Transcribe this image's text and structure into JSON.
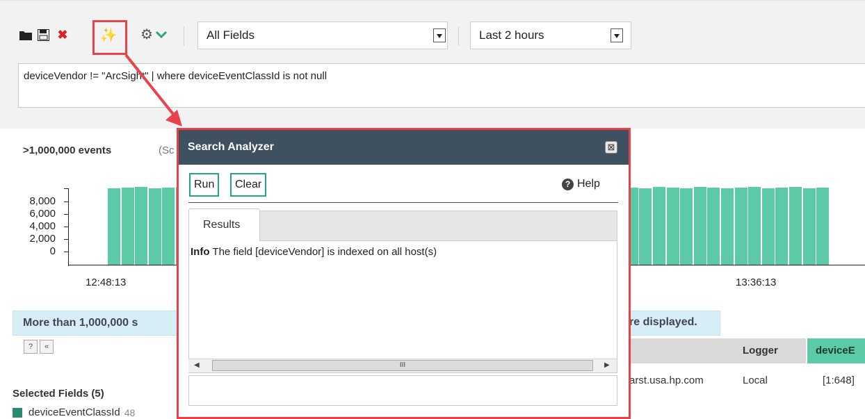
{
  "toolbar": {
    "icons": [
      "folder-icon",
      "save-icon",
      "delete-icon",
      "search-analyzer-icon",
      "settings-icon",
      "chevron-down-icon"
    ],
    "fields_select": "All Fields",
    "time_select": "Last 2 hours",
    "query": "deviceVendor != \"ArcSight\" | where deviceEventClassId is not null"
  },
  "summary": {
    "events_count": ">1,000,000 events",
    "events_suffix": "(Sc"
  },
  "histogram": {
    "yticks": [
      "8,000",
      "6,000",
      "4,000",
      "2,000",
      "0"
    ],
    "xticks": [
      "12:48:13",
      "13:36:13"
    ],
    "bar_color": "#5ccaa7"
  },
  "banner": {
    "text": "More than 1,000,000 s",
    "tail": "re displayed."
  },
  "table": {
    "col_logger": "Logger",
    "col_device": "deviceE",
    "row": {
      "host": "arst.usa.hp.com",
      "logger": "Local",
      "device": "[1:648]"
    }
  },
  "fields_panel": {
    "title": "Selected Fields (5)",
    "field": "deviceEventClassId",
    "count": "48"
  },
  "dialog": {
    "title": "Search Analyzer",
    "close": "⊠",
    "run": "Run",
    "clear": "Clear",
    "help": "Help",
    "tab": "Results",
    "info_label": "Info",
    "info_text": "The field [deviceVendor] is indexed on all host(s)",
    "scroll_thumb": "III"
  },
  "colors": {
    "highlight": "#e8434a",
    "accent": "#1ea784",
    "dialog_header": "#3f5060"
  }
}
